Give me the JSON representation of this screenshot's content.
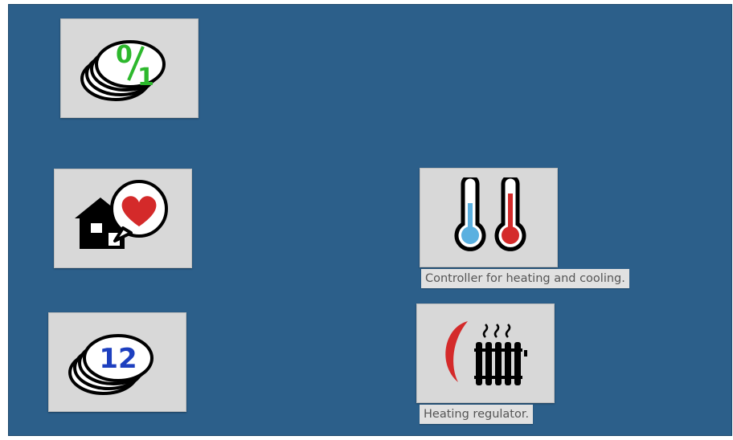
{
  "tiles": [
    {
      "id": "binary-counter",
      "icon": "coin-stack-binary-icon",
      "text": "0/1",
      "text_color": "#2db82d"
    },
    {
      "id": "home-favorite",
      "icon": "house-heart-icon",
      "heart_color": "#d42a2a"
    },
    {
      "id": "counter-12",
      "icon": "coin-stack-number-icon",
      "text": "12",
      "text_color": "#1d3fbf"
    },
    {
      "id": "heating-cooling",
      "icon": "thermometers-hot-cold-icon",
      "cold_color": "#5ab0e0",
      "hot_color": "#d42a2a",
      "caption": "Controller for heating and cooling."
    },
    {
      "id": "heating-regulator",
      "icon": "radiator-icon",
      "accent_color": "#d42a2a",
      "caption": "Heating regulator."
    }
  ],
  "colors": {
    "background": "#2c5f8a",
    "tile": "#d8d8d8",
    "caption_bg": "#e1e1e1",
    "caption_text": "#555555"
  }
}
